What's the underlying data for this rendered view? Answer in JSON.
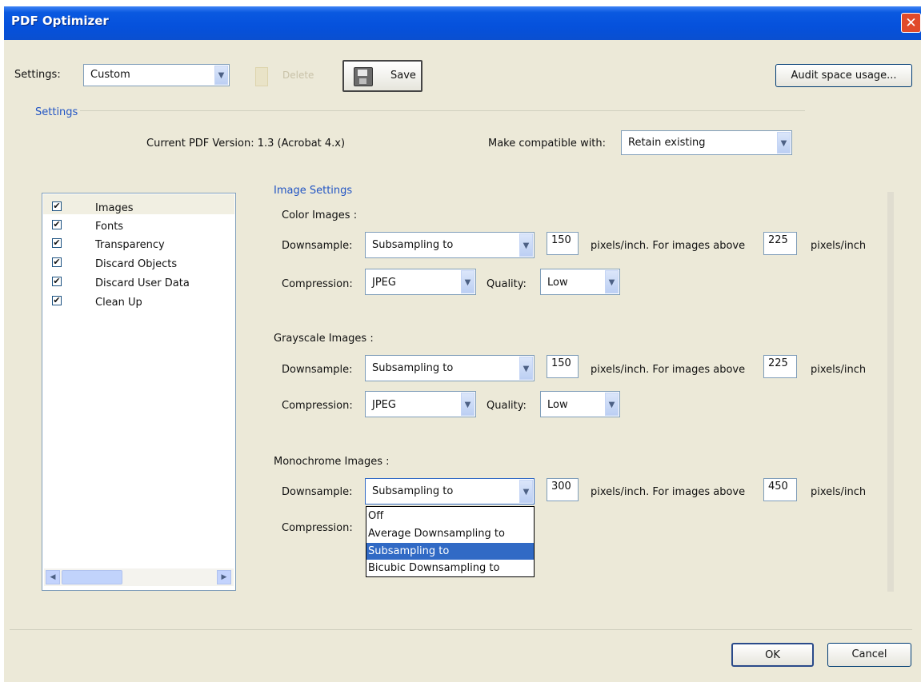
{
  "window": {
    "title": "PDF Optimizer",
    "close_glyph": "✕"
  },
  "toolbar": {
    "settings_label": "Settings:",
    "settings_value": "Custom",
    "delete_label": "Delete",
    "save_label": "Save",
    "audit_label": "Audit space usage..."
  },
  "settings_section": {
    "title": "Settings",
    "current_version": "Current PDF Version: 1.3 (Acrobat 4.x)",
    "compat_label": "Make compatible with:",
    "compat_value": "Retain existing"
  },
  "panels": [
    {
      "label": "Images",
      "checked": true
    },
    {
      "label": "Fonts",
      "checked": true
    },
    {
      "label": "Transparency",
      "checked": true
    },
    {
      "label": "Discard Objects",
      "checked": true
    },
    {
      "label": "Discard User Data",
      "checked": true
    },
    {
      "label": "Clean Up",
      "checked": true
    }
  ],
  "check_glyph": "✔",
  "image_settings": {
    "title": "Image Settings",
    "downsample_label": "Downsample:",
    "compression_label": "Compression:",
    "quality_label": "Quality:",
    "ppi_above_label": "pixels/inch. For images above",
    "ppi_label": "pixels/inch",
    "color": {
      "heading": "Color Images :",
      "downsample": "Subsampling to",
      "ppi": "150",
      "above": "225",
      "compression": "JPEG",
      "quality": "Low"
    },
    "grayscale": {
      "heading": "Grayscale Images :",
      "downsample": "Subsampling to",
      "ppi": "150",
      "above": "225",
      "compression": "JPEG",
      "quality": "Low"
    },
    "monochrome": {
      "heading": "Monochrome Images :",
      "downsample": "Subsampling to",
      "ppi": "300",
      "above": "450"
    }
  },
  "downsample_options": [
    "Off",
    "Average Downsampling to",
    "Subsampling to",
    "Bicubic Downsampling to"
  ],
  "selected_option": "Subsampling to",
  "buttons": {
    "ok": "OK",
    "cancel": "Cancel"
  },
  "colors": {
    "accent": "#316ac5",
    "titlebar": "#0551dc",
    "dialog_bg": "#ece9d8",
    "section_label": "#2255c4"
  }
}
